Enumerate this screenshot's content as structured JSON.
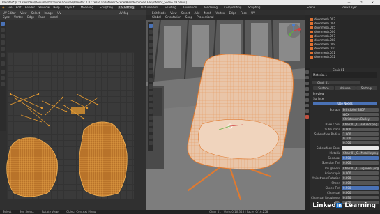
{
  "window": {
    "title": "Blender* [C:\\Users\\dan\\Documents\\Online Courses\\Blender 2.8 Create an Interior Scene\\Blender Scene File\\Interior_Scene 09.blend]",
    "controls": "— ❐ ✕"
  },
  "menubar": {
    "items": [
      "File",
      "Edit",
      "Render",
      "Window",
      "Help"
    ],
    "workspaces": [
      "Layout",
      "Modeling",
      "Sculpting",
      "UV Editing",
      "Texture Paint",
      "Shading",
      "Animation",
      "Rendering",
      "Compositing",
      "Scripting"
    ],
    "active_workspace": "UV Editing",
    "scene": "Scene",
    "view_layer": "View Layer"
  },
  "uv_editor": {
    "header": [
      "UV Editor",
      "View",
      "Select",
      "Image",
      "UV"
    ],
    "subheader": [
      "Sync",
      "Vertex",
      "Edge",
      "Face",
      "Island"
    ],
    "image_name": "UVMap"
  },
  "viewport": {
    "header": [
      "Edit Mode",
      "View",
      "Select",
      "Add",
      "Mesh",
      "Vertex",
      "Edge",
      "Face",
      "UV"
    ],
    "subheader": [
      "Global",
      "Orientation",
      "Snap",
      "Proportional"
    ],
    "view_label": "User Perspective"
  },
  "outliner": {
    "items": [
      "door.mesh.003",
      "door.mesh.004",
      "door.mesh.005",
      "door.mesh.006",
      "door.mesh.007",
      "door.mesh.008",
      "door.mesh.009",
      "door.mesh.010",
      "door.mesh.011",
      "door.mesh.012"
    ]
  },
  "properties": {
    "object": "Chair 01",
    "material_slot": "Material.1",
    "material_name": "Chair 01",
    "sections": [
      "Preview",
      "Surface"
    ],
    "tabs": [
      "Surface",
      "Volume",
      "Settings"
    ],
    "surface_button": "Use Nodes",
    "rows": [
      {
        "label": "Surface",
        "value": "Principled BSDF"
      },
      {
        "label": "",
        "value": "GGX"
      },
      {
        "label": "",
        "value": "Christensen-Burley"
      },
      {
        "label": "Base Color",
        "value": "Chair 01_C...seColor.png"
      },
      {
        "label": "Subsurface",
        "value": "0.000"
      },
      {
        "label": "Subsurface Radius",
        "value": "1.000"
      },
      {
        "label": "",
        "value": "0.200"
      },
      {
        "label": "",
        "value": "0.100"
      },
      {
        "label": "Subsurface Color",
        "value": ""
      },
      {
        "label": "Metallic",
        "value": "Chair 01_C...Metallic.png"
      },
      {
        "label": "Specular",
        "value": "0.500"
      },
      {
        "label": "Specular Tint",
        "value": "0.000"
      },
      {
        "label": "Roughness",
        "value": "Chair 01_C...ughness.png"
      },
      {
        "label": "Anisotropic",
        "value": "0.000"
      },
      {
        "label": "Anisotropic Rotation",
        "value": "0.000"
      },
      {
        "label": "Sheen",
        "value": "0.000"
      },
      {
        "label": "Sheen Tint",
        "value": "0.500"
      },
      {
        "label": "Clearcoat",
        "value": "0.000"
      },
      {
        "label": "Clearcoat Roughness",
        "value": "0.030"
      },
      {
        "label": "IOR",
        "value": "1.450"
      }
    ]
  },
  "statusbar": {
    "items": [
      "Select",
      "Box Select",
      "Rotate View",
      "Object Context Menu"
    ],
    "stats": "Chair 01 | Verts 0/16,348 | Faces 0/16,258"
  },
  "watermark": {
    "text": "Linked",
    "badge": "in",
    "suffix": " Learning"
  },
  "colors": {
    "accent": "#4a72b6",
    "uv_selection": "#f0a030",
    "mesh_orange": "#e8a060"
  }
}
